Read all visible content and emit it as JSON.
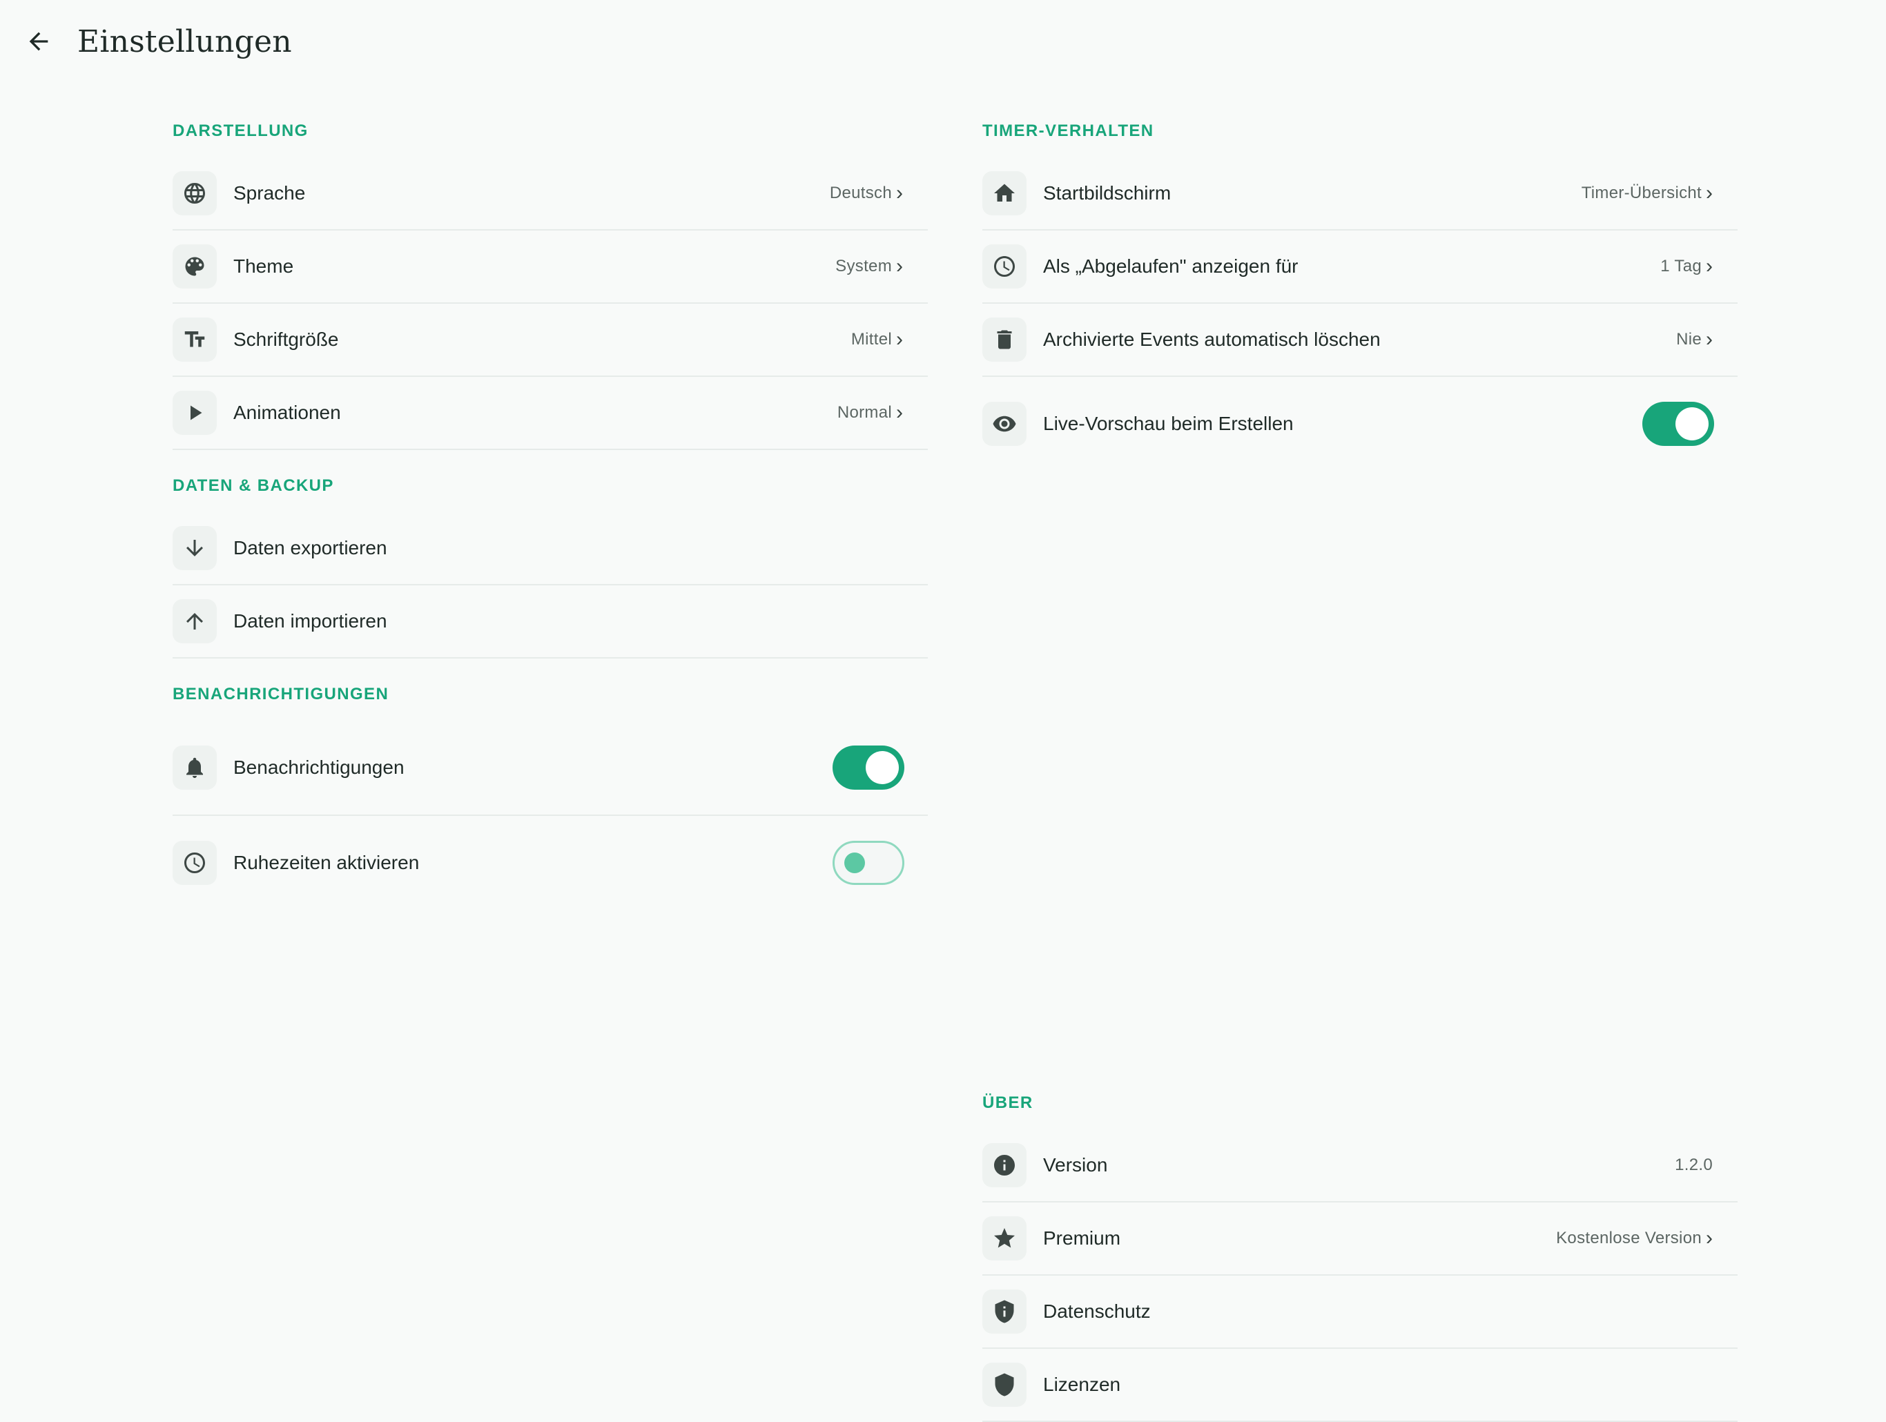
{
  "header": {
    "title": "Einstellungen",
    "back_icon": "arrow-back-icon"
  },
  "colors": {
    "accent": "#18a57a",
    "background": "#f8faf9",
    "icon_tile": "#eef2f0"
  },
  "sections": {
    "darstellung": {
      "title": "DARSTELLUNG",
      "items": [
        {
          "label": "Sprache",
          "value": "Deutsch",
          "icon": "globe-icon"
        },
        {
          "label": "Theme",
          "value": "System",
          "icon": "palette-icon"
        },
        {
          "label": "Schriftgröße",
          "value": "Mittel",
          "icon": "text-size-icon"
        },
        {
          "label": "Animationen",
          "value": "Normal",
          "icon": "play-icon"
        }
      ]
    },
    "daten_backup": {
      "title": "DATEN & BACKUP",
      "items": [
        {
          "label": "Daten exportieren",
          "icon": "arrow-down-icon"
        },
        {
          "label": "Daten importieren",
          "icon": "arrow-up-icon"
        }
      ]
    },
    "benachrichtigungen": {
      "title": "BENACHRICHTIGUNGEN",
      "items": [
        {
          "label": "Benachrichtigungen",
          "icon": "bell-icon",
          "toggle": "on"
        },
        {
          "label": "Ruhezeiten aktivieren",
          "icon": "clock-icon",
          "toggle": "off"
        }
      ]
    },
    "timer_verhalten": {
      "title": "TIMER-VERHALTEN",
      "items": [
        {
          "label": "Startbildschirm",
          "value": "Timer-Übersicht",
          "icon": "home-icon"
        },
        {
          "label": "Als „Abgelaufen\" anzeigen für",
          "value": "1 Tag",
          "icon": "clock-icon"
        },
        {
          "label": "Archivierte Events automatisch löschen",
          "value": "Nie",
          "icon": "trash-icon"
        },
        {
          "label": "Live-Vorschau beim Erstellen",
          "icon": "eye-icon",
          "toggle": "on"
        }
      ]
    },
    "ueber": {
      "title": "ÜBER",
      "items": [
        {
          "label": "Version",
          "value": "1.2.0",
          "icon": "info-icon"
        },
        {
          "label": "Premium",
          "value": "Kostenlose Version",
          "icon": "star-icon"
        },
        {
          "label": "Datenschutz",
          "icon": "shield-info-icon"
        },
        {
          "label": "Lizenzen",
          "icon": "shield-icon"
        }
      ]
    }
  },
  "chevron": "›"
}
